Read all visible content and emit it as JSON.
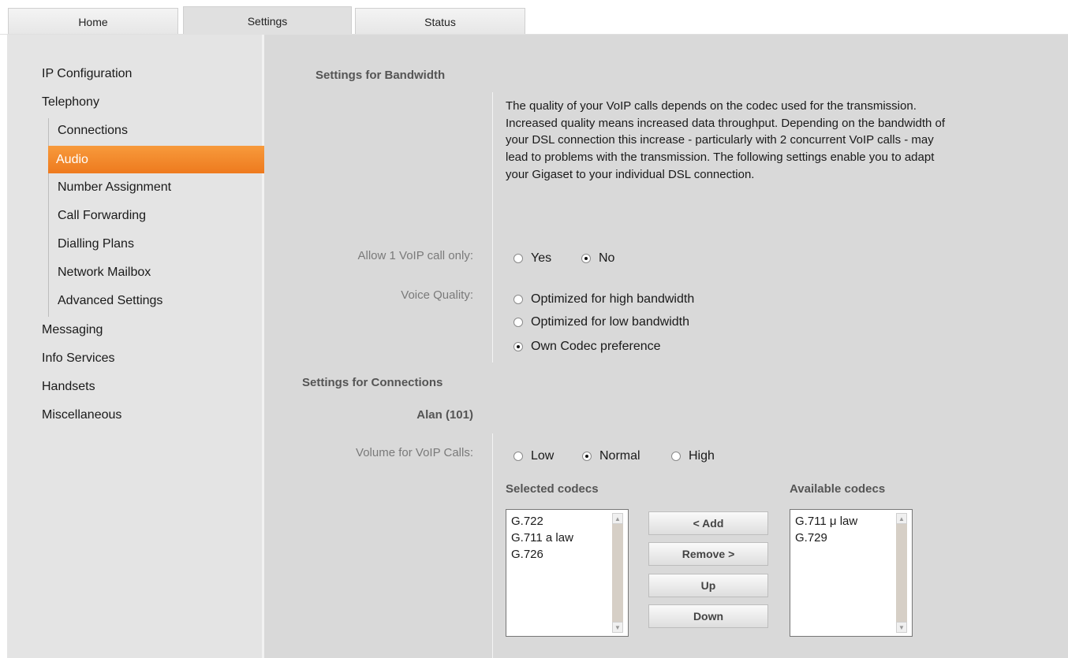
{
  "tabs": {
    "home": "Home",
    "settings": "Settings",
    "status": "Status"
  },
  "nav": {
    "ip_configuration": "IP Configuration",
    "telephony": "Telephony",
    "connections": "Connections",
    "audio": "Audio",
    "number_assignment": "Number Assignment",
    "call_forwarding": "Call Forwarding",
    "dialling_plans": "Dialling Plans",
    "network_mailbox": "Network Mailbox",
    "advanced_settings": "Advanced Settings",
    "messaging": "Messaging",
    "info_services": "Info Services",
    "handsets": "Handsets",
    "miscellaneous": "Miscellaneous",
    "active_item": "Audio"
  },
  "bandwidth": {
    "title": "Settings for Bandwidth",
    "description": "The quality of your VoIP calls depends on the codec used for the transmission. Increased quality means increased data throughput. Depending on the bandwidth of your DSL connection this increase - particularly with 2 concurrent VoIP calls - may lead to problems with the transmission. The following settings enable you to adapt your Gigaset to your individual DSL connection.",
    "allow_one_call_label": "Allow 1 VoIP call only:",
    "allow_one_call_yes": "Yes",
    "allow_one_call_no": "No",
    "allow_one_call_selected": "No",
    "voice_quality_label": "Voice Quality:",
    "voice_quality_high": "Optimized for high bandwidth",
    "voice_quality_low": "Optimized for low bandwidth",
    "voice_quality_own": "Own Codec preference",
    "voice_quality_selected": "Own Codec preference"
  },
  "connections": {
    "title": "Settings for Connections",
    "connection_name": "Alan (101)",
    "volume_label": "Volume for VoIP Calls:",
    "volume_low": "Low",
    "volume_normal": "Normal",
    "volume_high": "High",
    "volume_selected": "Normal",
    "selected_codecs_title": "Selected codecs",
    "available_codecs_title": "Available codecs",
    "selected_codecs": [
      "G.722",
      "G.711 a law",
      "G.726"
    ],
    "available_codecs": [
      "G.711 μ law",
      "G.729"
    ],
    "add_button": "< Add",
    "remove_button": "Remove >",
    "up_button": "Up",
    "down_button": "Down"
  },
  "colors": {
    "active_nav": "#f08a2e",
    "sidebar_bg": "#e4e4e4",
    "content_bg": "#d9d9d9"
  }
}
